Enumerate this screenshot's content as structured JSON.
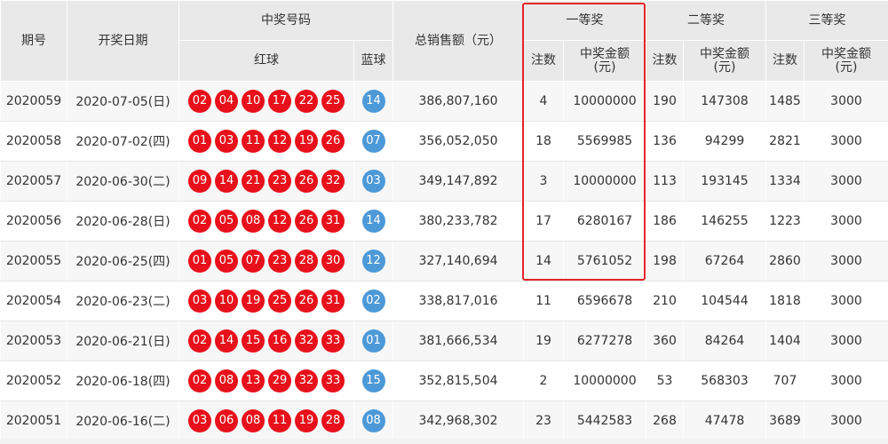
{
  "headers": {
    "period": "期号",
    "date": "开奖日期",
    "winning_numbers": "中奖号码",
    "red_ball": "红球",
    "blue_ball": "蓝球",
    "total_sales": "总销售额（元）",
    "first_prize": "一等奖",
    "second_prize": "二等奖",
    "third_prize": "三等奖",
    "count": "注数",
    "amount_line1": "中奖金额",
    "amount_line2": "(元)"
  },
  "colors": {
    "red_ball": "#e8101a",
    "blue_ball": "#4d99d8",
    "highlight": "#e5242b",
    "header_bg": "#e9e9e9"
  },
  "rows": [
    {
      "period": "2020059",
      "date": "2020-07-05(日)",
      "red": [
        "02",
        "04",
        "10",
        "17",
        "22",
        "25"
      ],
      "blue": "14",
      "sales": "386,807,160",
      "p1_count": "4",
      "p1_amount": "10000000",
      "p2_count": "190",
      "p2_amount": "147308",
      "p3_count": "1485",
      "p3_amount": "3000"
    },
    {
      "period": "2020058",
      "date": "2020-07-02(四)",
      "red": [
        "01",
        "03",
        "11",
        "12",
        "19",
        "26"
      ],
      "blue": "07",
      "sales": "356,052,050",
      "p1_count": "18",
      "p1_amount": "5569985",
      "p2_count": "136",
      "p2_amount": "94299",
      "p3_count": "2821",
      "p3_amount": "3000"
    },
    {
      "period": "2020057",
      "date": "2020-06-30(二)",
      "red": [
        "09",
        "14",
        "21",
        "23",
        "26",
        "32"
      ],
      "blue": "03",
      "sales": "349,147,892",
      "p1_count": "3",
      "p1_amount": "10000000",
      "p2_count": "113",
      "p2_amount": "193145",
      "p3_count": "1334",
      "p3_amount": "3000"
    },
    {
      "period": "2020056",
      "date": "2020-06-28(日)",
      "red": [
        "02",
        "05",
        "08",
        "12",
        "26",
        "31"
      ],
      "blue": "14",
      "sales": "380,233,782",
      "p1_count": "17",
      "p1_amount": "6280167",
      "p2_count": "186",
      "p2_amount": "146255",
      "p3_count": "1223",
      "p3_amount": "3000"
    },
    {
      "period": "2020055",
      "date": "2020-06-25(四)",
      "red": [
        "01",
        "05",
        "07",
        "23",
        "28",
        "30"
      ],
      "blue": "12",
      "sales": "327,140,694",
      "p1_count": "14",
      "p1_amount": "5761052",
      "p2_count": "198",
      "p2_amount": "67264",
      "p3_count": "2860",
      "p3_amount": "3000"
    },
    {
      "period": "2020054",
      "date": "2020-06-23(二)",
      "red": [
        "03",
        "10",
        "19",
        "25",
        "26",
        "31"
      ],
      "blue": "02",
      "sales": "338,817,016",
      "p1_count": "11",
      "p1_amount": "6596678",
      "p2_count": "210",
      "p2_amount": "104544",
      "p3_count": "1818",
      "p3_amount": "3000"
    },
    {
      "period": "2020053",
      "date": "2020-06-21(日)",
      "red": [
        "02",
        "14",
        "15",
        "16",
        "32",
        "33"
      ],
      "blue": "01",
      "sales": "381,666,534",
      "p1_count": "19",
      "p1_amount": "6277278",
      "p2_count": "360",
      "p2_amount": "84264",
      "p3_count": "1404",
      "p3_amount": "3000"
    },
    {
      "period": "2020052",
      "date": "2020-06-18(四)",
      "red": [
        "02",
        "08",
        "13",
        "29",
        "32",
        "33"
      ],
      "blue": "15",
      "sales": "352,815,504",
      "p1_count": "2",
      "p1_amount": "10000000",
      "p2_count": "53",
      "p2_amount": "568303",
      "p3_count": "707",
      "p3_amount": "3000"
    },
    {
      "period": "2020051",
      "date": "2020-06-16(二)",
      "red": [
        "03",
        "06",
        "08",
        "11",
        "19",
        "28"
      ],
      "blue": "08",
      "sales": "342,968,302",
      "p1_count": "23",
      "p1_amount": "5442583",
      "p2_count": "268",
      "p2_amount": "47478",
      "p3_count": "3689",
      "p3_amount": "3000"
    }
  ]
}
